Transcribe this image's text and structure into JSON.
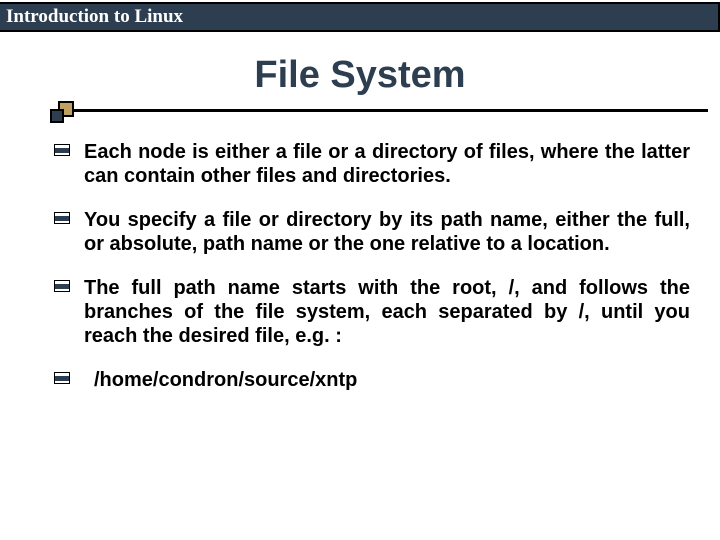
{
  "header": {
    "title": "Introduction to Linux"
  },
  "slide": {
    "title": "File System",
    "bullets": [
      "Each node is either a file or a directory of files, where the latter can contain other files and directories.",
      "You specify a file or directory by its path name, either the full, or absolute, path name or the one relative to a location.",
      "The full path name starts with the root, /, and follows the branches of the file system, each separated by /, until you reach the desired file, e.g. :"
    ],
    "example_path": "/home/condron/source/xntp"
  }
}
